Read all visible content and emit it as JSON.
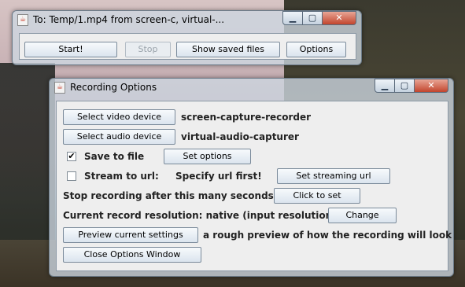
{
  "main_window": {
    "title": "To: Temp/1.mp4 from screen-c, virtual-...",
    "icon": "java-app-icon",
    "controls": {
      "minimize": "▁",
      "maximize": "▢",
      "close": "✕"
    },
    "buttons": {
      "start": "Start!",
      "stop": "Stop",
      "show_saved": "Show saved files",
      "options": "Options"
    }
  },
  "options_window": {
    "title": "Recording Options",
    "icon": "java-app-icon",
    "controls": {
      "minimize": "▁",
      "maximize": "▢",
      "close": "✕"
    },
    "video_device_button": "Select video device",
    "video_device_value": "screen-capture-recorder",
    "audio_device_button": "Select audio device",
    "audio_device_value": "virtual-audio-capturer",
    "save_to_file": {
      "label": "Save to file",
      "checked": true,
      "mark": "✔"
    },
    "set_options_button": "Set options",
    "stream_to_url": {
      "label": "Stream to url:",
      "checked": false,
      "mark": ""
    },
    "stream_status": "Specify url first!",
    "set_streaming_url_button": "Set streaming url",
    "stop_after_label": "Stop recording after this many seconds:",
    "click_to_set_button": "Click to set",
    "resolution_label": "Current record resolution: native (input resolution)",
    "change_button": "Change",
    "preview_button": "Preview current settings",
    "preview_desc": "a rough preview of how the recording will look",
    "close_button": "Close Options Window"
  }
}
